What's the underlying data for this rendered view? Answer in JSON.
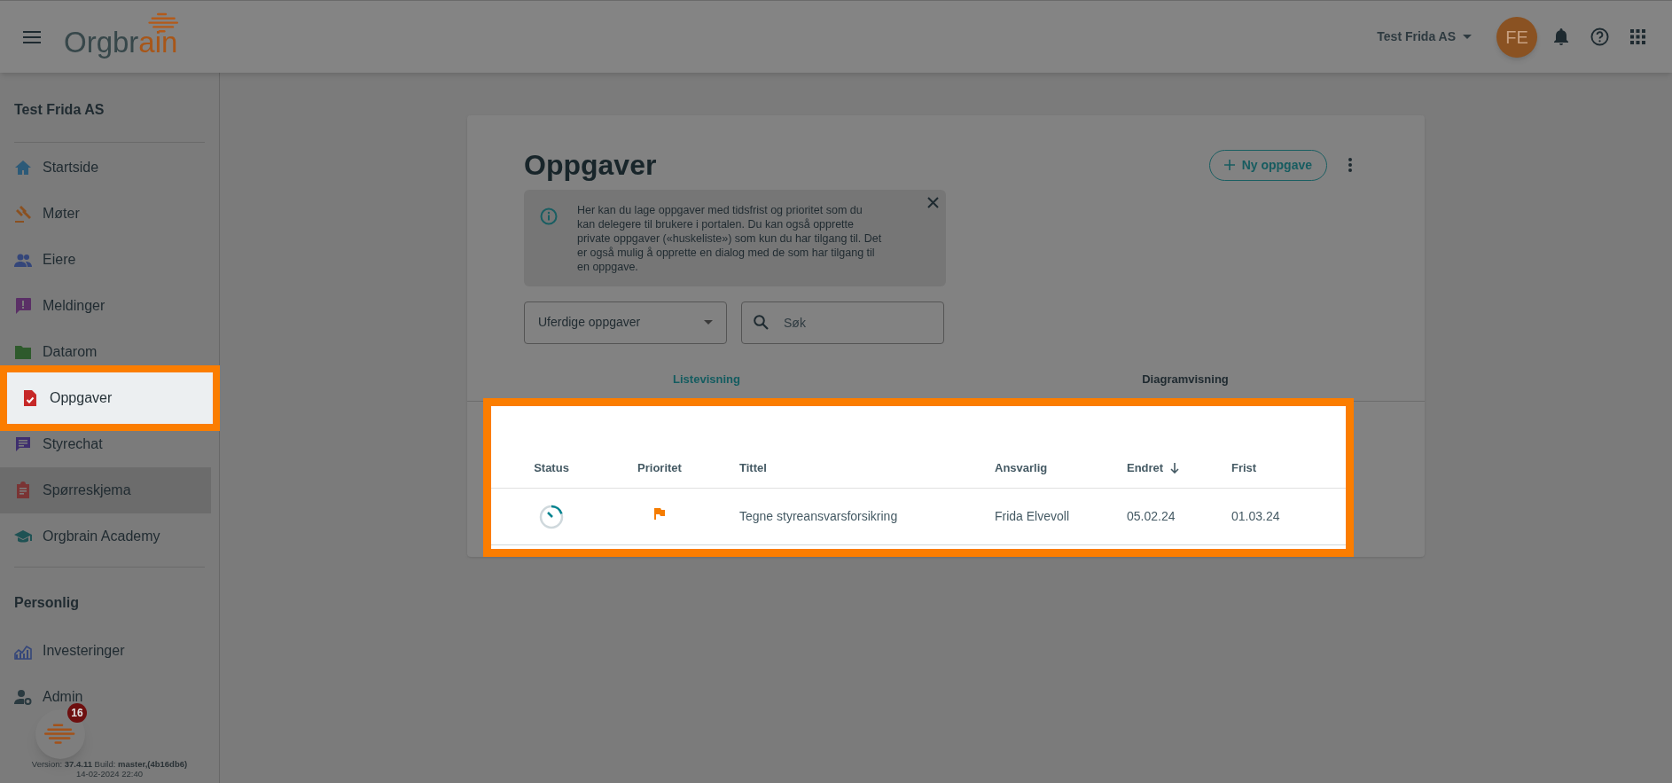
{
  "header": {
    "logo": [
      "Orgbr",
      "ain"
    ],
    "company": "Test Frida AS",
    "avatar": "FE"
  },
  "sidebar": {
    "title": "Test Frida AS",
    "items": [
      {
        "label": "Startside",
        "selected": false,
        "hovered": false
      },
      {
        "label": "Møter",
        "selected": false,
        "hovered": false
      },
      {
        "label": "Eiere",
        "selected": false,
        "hovered": false
      },
      {
        "label": "Meldinger",
        "selected": false,
        "hovered": false
      },
      {
        "label": "Datarom",
        "selected": false,
        "hovered": false
      },
      {
        "label": "Oppgaver",
        "selected": true,
        "hovered": false
      },
      {
        "label": "Styrechat",
        "selected": false,
        "hovered": false
      },
      {
        "label": "Spørreskjema",
        "selected": false,
        "hovered": true
      },
      {
        "label": "Orgbrain Academy",
        "selected": false,
        "hovered": false
      }
    ],
    "section": "Personlig",
    "personal_items": [
      {
        "label": "Investeringer",
        "selected": false
      },
      {
        "label": "Admin",
        "selected": false
      }
    ],
    "chat_badge": "16",
    "version": "Version: **37.4.11** Build: **master,(4b16db6)**",
    "build_date": "14-02-2024 22:40"
  },
  "card": {
    "title": "Oppgaver",
    "new_button": "Ny oppgave",
    "info": "Her kan du lage oppgaver med tidsfrist og prioritet som du kan delegere til brukere i portalen. Du kan også opprette private oppgaver («huskeliste») som kun du har tilgang til. Det er også mulig å opprette en dialog med de som har tilgang til en oppgave.",
    "filter": "Uferdige oppgaver",
    "search": {
      "placeholder": "Søk"
    },
    "tabs": [
      {
        "label": "Listevisning",
        "selected": true
      },
      {
        "label": "Diagramvisning",
        "selected": false
      }
    ],
    "table": {
      "highlighted": true,
      "columns": [
        "Status",
        "Prioritet",
        "Tittel",
        "Ansvarlig",
        "Endret",
        "Frist"
      ],
      "rows": [
        {
          "cells": [
            {
              "kind": "in-progress"
            },
            {
              "color": "#f57c00"
            },
            "Tegne styreansvarsforsikring",
            "Frida Elvevoll",
            "05.02.24",
            "01.03.24"
          ]
        }
      ]
    }
  }
}
